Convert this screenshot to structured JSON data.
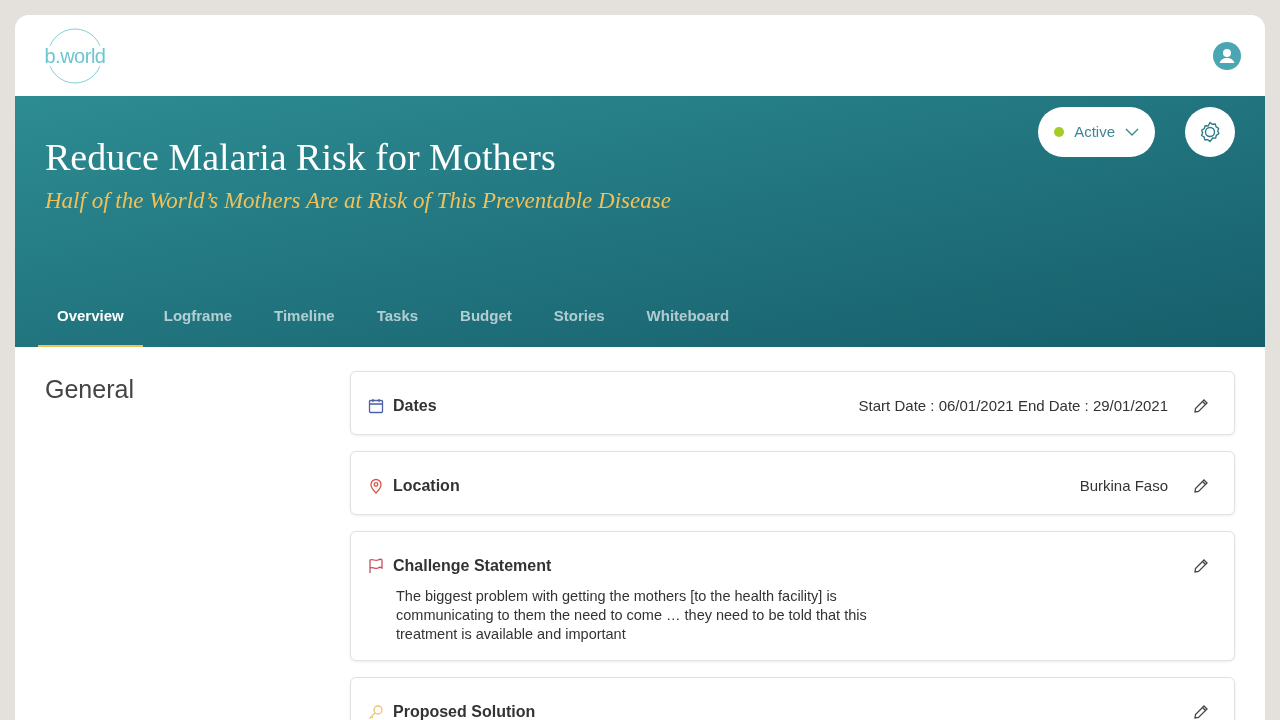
{
  "logo": "b.world",
  "project": {
    "title": "Reduce Malaria Risk for Mothers",
    "subtitle": "Half of the World’s Mothers Are at Risk of This Preventable Disease"
  },
  "status": {
    "label": "Active"
  },
  "tabs": [
    {
      "label": "Overview",
      "selected": true
    },
    {
      "label": "Logframe",
      "selected": false
    },
    {
      "label": "Timeline",
      "selected": false
    },
    {
      "label": "Tasks",
      "selected": false
    },
    {
      "label": "Budget",
      "selected": false
    },
    {
      "label": "Stories",
      "selected": false
    },
    {
      "label": "Whiteboard",
      "selected": false
    }
  ],
  "section_title": "General",
  "cards": [
    {
      "kind": "calendar",
      "title": "Dates",
      "value": "Start Date : 06/01/2021 End Date : 29/01/2021"
    },
    {
      "kind": "pin",
      "title": "Location",
      "value": "Burkina Faso"
    },
    {
      "kind": "flag",
      "title": "Challenge Statement",
      "text": "The biggest problem with getting the mothers [to the health facility] is communicating to them the need to come … they need to be told that this treatment is available and important"
    },
    {
      "kind": "key",
      "title": "Proposed Solution"
    }
  ]
}
